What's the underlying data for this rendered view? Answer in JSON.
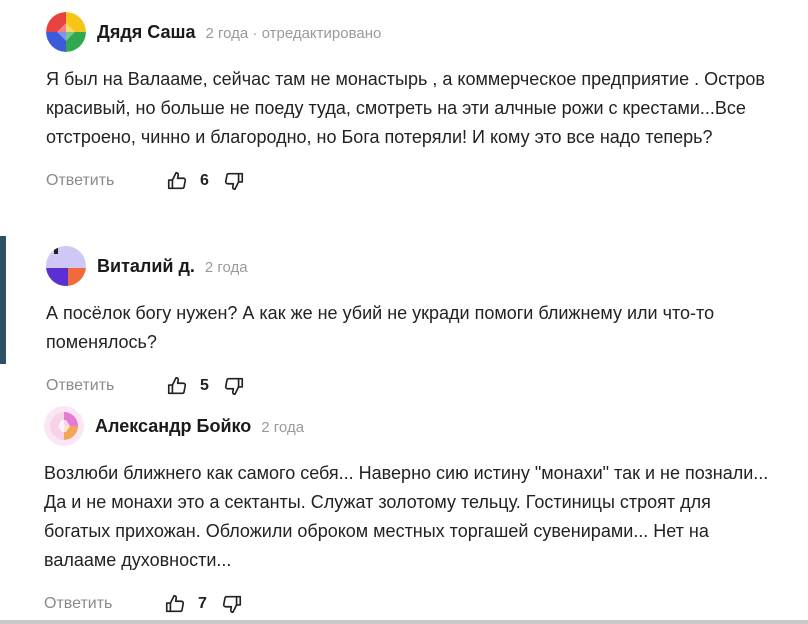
{
  "comments": [
    {
      "author": "Дядя Саша",
      "meta": "2 года · отредактировано",
      "text": "Я был на Валааме, сейчас там не монастырь , а коммерческое предприятие . Остров красивый, но больше не поеду туда, смотреть на эти алчные рожи с крестами...Все отстроено, чинно и благородно, но Бога потеряли! И кому это все надо теперь?",
      "reply_label": "Ответить",
      "likes": "6",
      "avatar_colors": [
        "#f5c518",
        "#e8423f",
        "#2fa84f",
        "#3b5bdb"
      ]
    },
    {
      "author": "Виталий д.",
      "meta": "2 года",
      "text": "А посёлок богу нужен? А как же не убий не укради помоги ближнему или что-то поменялось?",
      "reply_label": "Ответить",
      "likes": "5",
      "avatar_colors": [
        "#cfc7f5",
        "#5b2fd1",
        "#f06a3c",
        "#222222"
      ]
    },
    {
      "author": "Александр Бойко",
      "meta": "2 года",
      "text": "Возлюби ближнего как самого себя... Наверно сию истину \"монахи\" так и не познали... Да и не монахи это а сектанты. Служат золотому тельцу. Гостиницы строят для богатых прихожан. Обложили оброком местных торгашей сувенирами... Нет на валааме духовности...",
      "reply_label": "Ответить",
      "likes": "7",
      "avatar_colors": [
        "#f7d3ea",
        "#e77ad3",
        "#f2a65a",
        "#fbe7f3"
      ]
    }
  ],
  "icons": {
    "like": "thumbs-up-icon",
    "dislike": "thumbs-down-icon"
  }
}
